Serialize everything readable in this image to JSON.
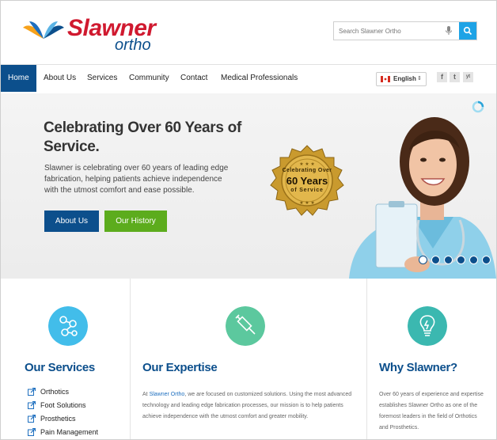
{
  "brand": {
    "name": "Slawner",
    "sub": "ortho"
  },
  "search": {
    "placeholder": "Search Slawner Ortho"
  },
  "nav": {
    "items": [
      "Home",
      "About Us",
      "Services",
      "Community",
      "Contact",
      "Medical Professionals"
    ],
    "active": "Home"
  },
  "language": {
    "label": "English"
  },
  "social": [
    "f",
    "t",
    "yt"
  ],
  "hero": {
    "title": "Celebrating Over 60 Years of Service.",
    "text": "Slawner is celebrating over 60 years of leading edge fabrication, helping patients achieve independence with the utmost comfort and ease possible.",
    "button_about": "About Us",
    "button_history": "Our History",
    "seal": {
      "line1": "Celebrating Over",
      "line2": "60 Years",
      "line3": "of Service"
    },
    "slides": 6,
    "active_slide": 1
  },
  "columns": {
    "services": {
      "title": "Our Services",
      "items": [
        "Orthotics",
        "Foot Solutions",
        "Prosthetics",
        "Pain Management"
      ]
    },
    "expertise": {
      "title": "Our Expertise",
      "text_prefix": "At ",
      "text_link": "Slawner Ortho",
      "text_rest": ", we are focused on customized solutions. Using the most advanced technology and leading edge fabrication processes, our mission is to help patients achieve independence with the utmost comfort and greater mobility."
    },
    "why": {
      "title": "Why Slawner?",
      "text": "Over 60 years of experience and expertise establishes Slawner Ortho as one of the foremost leaders in the field of Orthotics and Prosthetics."
    }
  },
  "colors": {
    "brand_red": "#d0192f",
    "brand_blue": "#0c4f8c",
    "accent_green": "#5cac1d",
    "search_blue": "#1ea3e6"
  }
}
